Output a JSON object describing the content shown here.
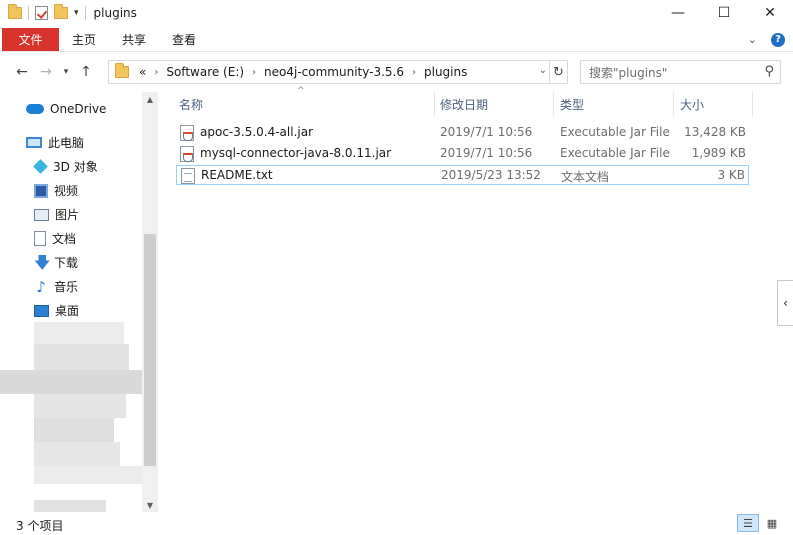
{
  "window": {
    "title": "plugins",
    "controls": {
      "minimize": "—",
      "maximize": "☐",
      "close": "✕"
    }
  },
  "ribbon": {
    "tabs": [
      "文件",
      "主页",
      "共享",
      "查看"
    ],
    "expand_icon": "⌄",
    "help": "?"
  },
  "address": {
    "prefix": "«",
    "crumbs": [
      "Software (E:)",
      "neo4j-community-3.5.6",
      "plugins"
    ],
    "search_placeholder": "搜索\"plugins\""
  },
  "nav": {
    "onedrive": "OneDrive",
    "this_pc": "此电脑",
    "items": [
      "3D 对象",
      "视频",
      "图片",
      "文档",
      "下载",
      "音乐",
      "桌面"
    ]
  },
  "columns": {
    "name": "名称",
    "date": "修改日期",
    "type": "类型",
    "size": "大小"
  },
  "files": [
    {
      "name": "apoc-3.5.0.4-all.jar",
      "date": "2019/7/1 10:56",
      "type": "Executable Jar File",
      "size": "13,428 KB",
      "icon": "jar-file-icon"
    },
    {
      "name": "mysql-connector-java-8.0.11.jar",
      "date": "2019/7/1 10:56",
      "type": "Executable Jar File",
      "size": "1,989 KB",
      "icon": "jar-file-icon"
    },
    {
      "name": "README.txt",
      "date": "2019/5/23 13:52",
      "type": "文本文档",
      "size": "3 KB",
      "icon": "text-file-icon"
    }
  ],
  "status": {
    "item_count": "3 个项目"
  }
}
